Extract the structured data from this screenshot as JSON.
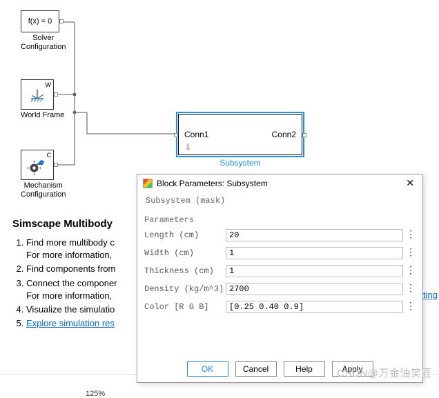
{
  "blocks": {
    "solver": {
      "text": "f(x) = 0",
      "label": "Solver\nConfiguration"
    },
    "world": {
      "label": "World Frame",
      "w_letter": "W"
    },
    "mech": {
      "label": "Mechanism\nConfiguration",
      "c_letter": "C"
    },
    "subsystem": {
      "conn1": "Conn1",
      "conn2": "Conn2",
      "label": "Subsystem"
    }
  },
  "help": {
    "title": "Simscape Multibody",
    "items": [
      {
        "text": "Find more multibody c",
        "sub": "For more information, "
      },
      {
        "text": "Find components from"
      },
      {
        "text": "Connect the componer",
        "sub": "For more information, "
      },
      {
        "text": "Visualize the simulatio"
      },
      {
        "text_link": "Explore simulation res"
      }
    ],
    "far_link": "ting"
  },
  "zoom": "125%",
  "dialog": {
    "title": "Block Parameters: Subsystem",
    "mask": "Subsystem (mask)",
    "params_header": "Parameters",
    "params": [
      {
        "label": "Length (cm)",
        "value": "20"
      },
      {
        "label": "Width (cm)",
        "value": "1"
      },
      {
        "label": "Thickness (cm)",
        "value": "1"
      },
      {
        "label": "Density (kg/m^3)",
        "value": "2700"
      },
      {
        "label": "Color [R G B]",
        "value": "[0.25 0.40 0.9]"
      }
    ],
    "buttons": {
      "ok": "OK",
      "cancel": "Cancel",
      "help": "Help",
      "apply": "Apply"
    }
  },
  "watermark": "CSDN@万金油笑匠"
}
